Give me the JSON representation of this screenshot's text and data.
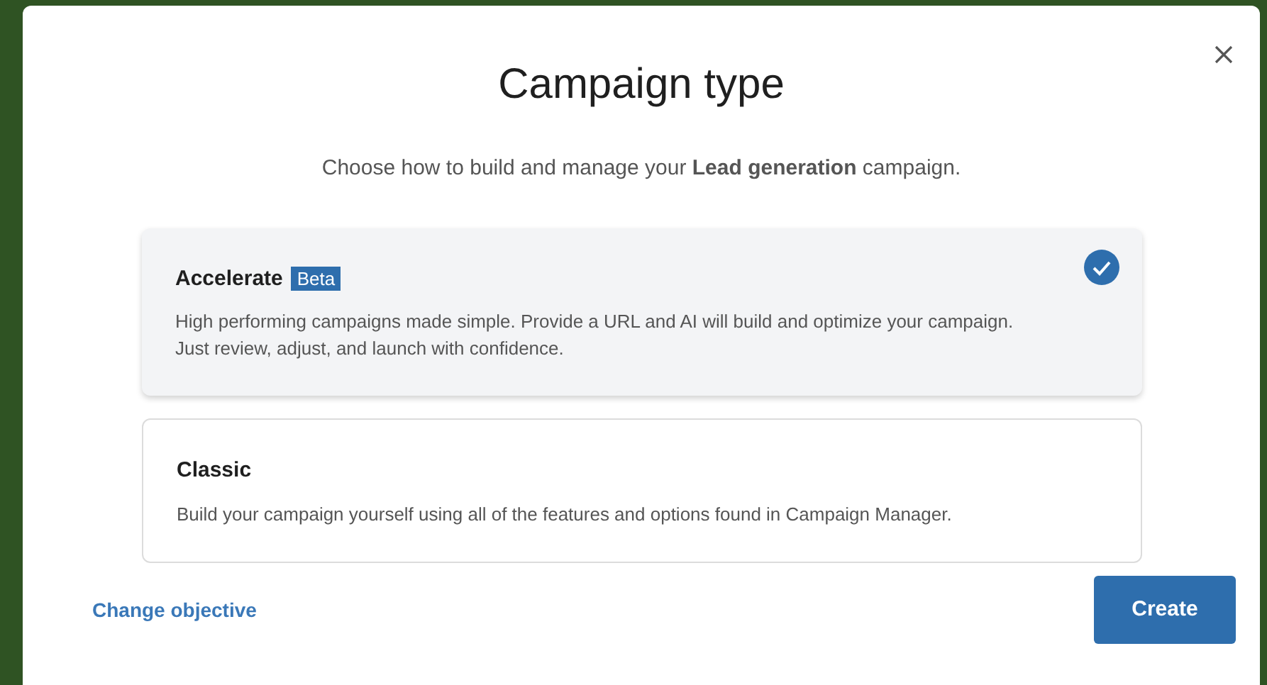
{
  "dialog": {
    "title": "Campaign type",
    "subtitle": "Choose how to build and manage your **Lead generation** campaign.",
    "options": [
      {
        "title": "Accelerate",
        "badge": "Beta",
        "description": "High performing campaigns made simple. Provide a URL and AI will build and optimize your campaign. Just review, adjust, and launch with confidence.",
        "selected": true
      },
      {
        "title": "Classic",
        "description": "Build your campaign yourself using all of the features and options found in Campaign Manager.",
        "selected": false
      }
    ],
    "link": "Change objective",
    "button": "Create"
  }
}
